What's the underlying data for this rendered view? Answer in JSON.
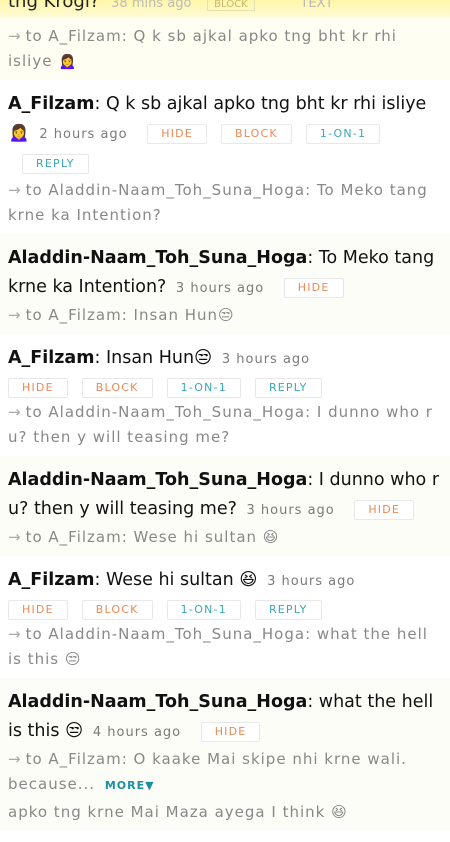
{
  "top_partial": {
    "text": "tng Krogi?",
    "time": "38 mins ago",
    "btn_a": "BLOCK",
    "btn_b": "TEXT",
    "reply_prefix": "to A_Filzam: ",
    "reply_text": "Q k sb ajkal apko tng bht kr rhi isliye 🙍‍♀️"
  },
  "buttons": {
    "hide": "HIDE",
    "block": "BLOCK",
    "one_on_one": "1-ON-1",
    "reply": "REPLY",
    "more": "MORE"
  },
  "messages": [
    {
      "author": "A_Filzam",
      "text": "Q k sb ajkal apko tng bht kr rhi isliye 🙍‍♀️",
      "time": "2 hours ago",
      "reply": "to Aladdin-Naam_Toh_Suna_Hoga: To Meko tang krne ka Intention?"
    },
    {
      "author": "Aladdin-Naam_Toh_Suna_Hoga",
      "text": "To Meko tang krne ka Intention?",
      "time": "3 hours ago",
      "reply": "to A_Filzam: Insan Hun😒"
    },
    {
      "author": "A_Filzam",
      "text": "Insan Hun😒",
      "time": "3 hours ago",
      "reply": "to Aladdin-Naam_Toh_Suna_Hoga: I dunno who r u? then y will teasing me?"
    },
    {
      "author": "Aladdin-Naam_Toh_Suna_Hoga",
      "text": "I dunno who r u? then y will teasing me?",
      "time": "3 hours ago",
      "reply": "to A_Filzam: Wese hi sultan 😆"
    },
    {
      "author": "A_Filzam",
      "text": "Wese hi sultan 😆",
      "time": "3 hours ago",
      "reply": "to Aladdin-Naam_Toh_Suna_Hoga: what the hell is this 😒"
    },
    {
      "author": "Aladdin-Naam_Toh_Suna_Hoga",
      "text": "what the hell is this 😒",
      "time": "4 hours ago",
      "reply": "to A_Filzam: O kaake Mai skipe nhi krne wali. because...",
      "tail": "apko tng krne Mai Maza ayega I think 😆"
    }
  ]
}
